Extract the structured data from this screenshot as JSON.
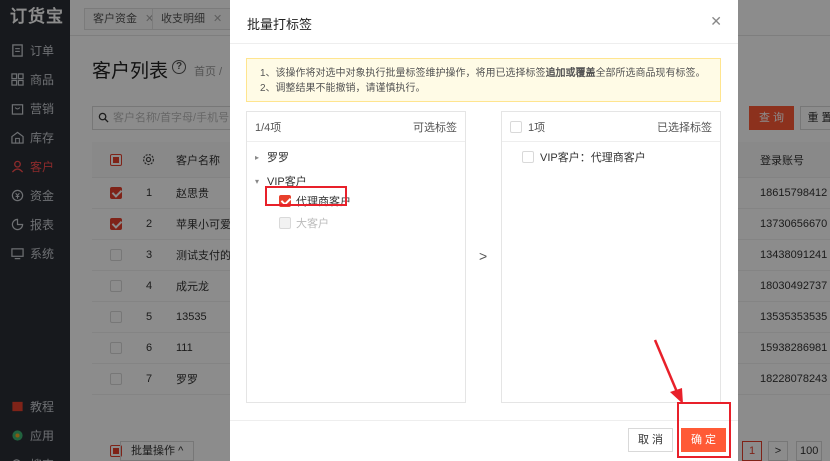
{
  "app": {
    "logo": "订货宝"
  },
  "sidebar": {
    "items": [
      {
        "label": "订单",
        "icon": "document-icon"
      },
      {
        "label": "商品",
        "icon": "grid-icon"
      },
      {
        "label": "营销",
        "icon": "bag-icon"
      },
      {
        "label": "库存",
        "icon": "warehouse-icon"
      },
      {
        "label": "客户",
        "icon": "user-icon",
        "active": true
      },
      {
        "label": "资金",
        "icon": "money-icon"
      },
      {
        "label": "报表",
        "icon": "chart-icon"
      },
      {
        "label": "系统",
        "icon": "monitor-icon"
      }
    ],
    "bottom": [
      {
        "label": "教程",
        "icon": "book-icon"
      },
      {
        "label": "应用",
        "icon": "apps-icon"
      },
      {
        "label": "搜索",
        "icon": "search-icon"
      }
    ]
  },
  "tabs": [
    {
      "label": "客户资金"
    },
    {
      "label": "收支明细"
    }
  ],
  "main": {
    "title": "客户列表",
    "breadcrumb": "首页 /",
    "search_placeholder": "客户名称/首字母/手机号",
    "query_label": "查 询",
    "reset_label": "重 置",
    "columns": {
      "name": "客户名称",
      "account": "登录账号"
    },
    "rows": [
      {
        "idx": "1",
        "name": "赵思贵",
        "account": "18615798412",
        "checked": true
      },
      {
        "idx": "2",
        "name": "苹果小可爱",
        "account": "13730656670",
        "checked": true
      },
      {
        "idx": "3",
        "name": "测试支付的",
        "account": "13438091241",
        "checked": false
      },
      {
        "idx": "4",
        "name": "成元龙",
        "account": "18030492737",
        "checked": false
      },
      {
        "idx": "5",
        "name": "13535",
        "account": "13535353535",
        "checked": false
      },
      {
        "idx": "6",
        "name": "111",
        "account": "15938286981",
        "checked": false
      },
      {
        "idx": "7",
        "name": "罗罗",
        "account": "18228078243",
        "checked": false
      }
    ],
    "batch_label": "批量操作",
    "pager": {
      "current": "1",
      "next": ">",
      "size": "100"
    }
  },
  "modal": {
    "title": "批量打标签",
    "notice_line1_pre": "1、该操作将对选中对象执行批量标签维护操作，将用已选择标签",
    "notice_line1_bold": "追加或覆盖",
    "notice_line1_post": "全部所选商品现有标签。",
    "notice_line2": "2、调整结果不能撤销，请谨慎执行。",
    "left": {
      "count": "1/4项",
      "title": "可选标签",
      "tree": [
        {
          "label": "罗罗"
        },
        {
          "label": "VIP客户"
        },
        {
          "label": "代理商客户"
        },
        {
          "label": "大客户"
        }
      ]
    },
    "right": {
      "count": "1项",
      "title": "已选择标签",
      "items": [
        {
          "label": "VIP客户：代理商客户"
        }
      ]
    },
    "transfer_symbol": ">",
    "cancel_label": "取 消",
    "ok_label": "确 定"
  },
  "colors": {
    "accent": "#ff5a36",
    "highlight": "#e8202a",
    "sidebar_bg": "#2b2f36"
  }
}
